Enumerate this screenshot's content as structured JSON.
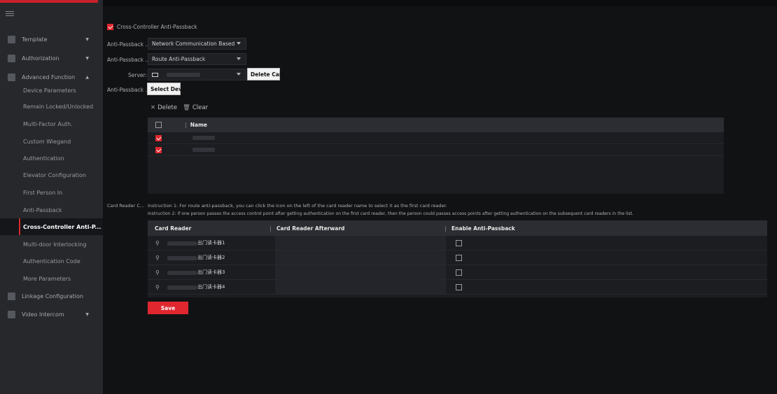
{
  "sidebar": {
    "groups": [
      {
        "label": "Template",
        "expanded": false
      },
      {
        "label": "Authorization",
        "expanded": false
      },
      {
        "label": "Advanced Function",
        "expanded": true
      },
      {
        "label": "Linkage Configuration",
        "expanded": false
      },
      {
        "label": "Video Intercom",
        "expanded": false
      }
    ],
    "items": [
      "Device Parameters",
      "Remain Locked/Unlocked",
      "Multi-Factor Auth.",
      "Custom Wiegand",
      "Authentication",
      "Elevator Configuration",
      "First Person In",
      "Anti-Passback",
      "Cross-Controller Anti-P...",
      "Multi-door Interlocking",
      "Authentication Code",
      "More Parameters"
    ],
    "active_item": "Cross-Controller Anti-P..."
  },
  "form": {
    "enable_label": "Cross-Controller Anti-Passback",
    "mode_label": "Anti-Passback ...",
    "mode_value": "Network Communication Based",
    "type_label": "Anti-Passback ...",
    "type_value": "Route Anti-Passback",
    "server_label": "Server:",
    "delete_card_button": "Delete Car...",
    "device_label": "Anti-Passback ...",
    "select_device_button": "Select Dev..."
  },
  "toolbar": {
    "delete_label": "Delete",
    "clear_label": "Clear"
  },
  "device_table": {
    "header_name": "Name",
    "rows": [
      {
        "checked": true
      },
      {
        "checked": true
      }
    ]
  },
  "card_reader": {
    "label": "Card Reader C...",
    "instruction_1": "Instruction 1: For route anti-passback, you can click the icon on the left of the card reader name to select it as the first card reader.",
    "instruction_2": "Instruction 2: If one person passes the access control point after getting authentication on the first card reader, then the person could passes access points after getting authentication on the subsequent card readers in the list.",
    "headers": [
      "Card Reader",
      "Card Reader Afterward",
      "Enable Anti-Passback"
    ],
    "rows": [
      {
        "reader": "出门读卡器1",
        "enabled": false
      },
      {
        "reader": "出门读卡器2",
        "enabled": false
      },
      {
        "reader": "出门读卡器3",
        "enabled": false
      },
      {
        "reader": "出门读卡器4",
        "enabled": false
      }
    ]
  },
  "save_label": "Save",
  "colors": {
    "accent": "#e0272f",
    "sidebar_bg": "#26282c",
    "main_bg": "#111214"
  }
}
